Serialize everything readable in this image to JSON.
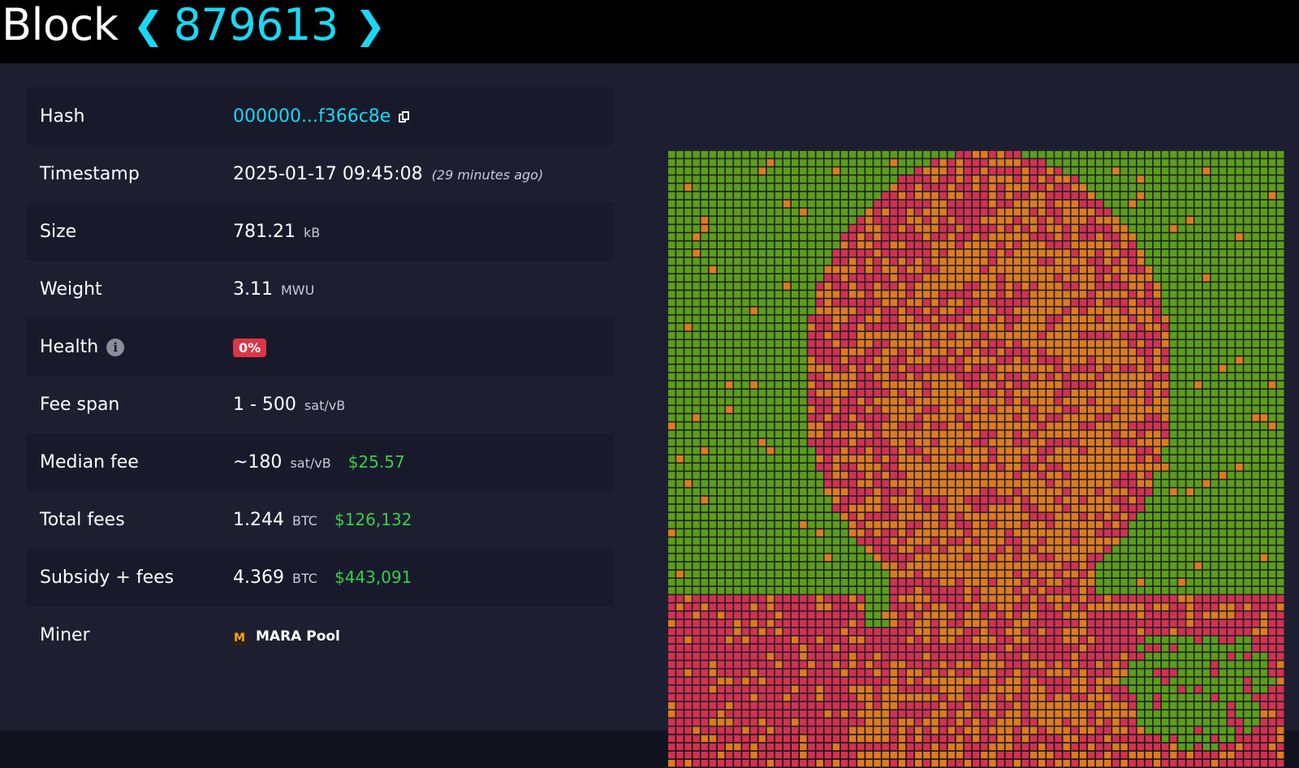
{
  "header": {
    "title": "Block",
    "prev_label": "❮",
    "block_height": "879613",
    "next_label": "❯"
  },
  "details": [
    {
      "label": "Hash",
      "value": "000000...f366c8e",
      "icon": "copy-icon"
    },
    {
      "label": "Timestamp",
      "value": "2025-01-17 09:45:08",
      "note": "(29 minutes ago)"
    },
    {
      "label": "Size",
      "value": "781.21",
      "unit": "kB"
    },
    {
      "label": "Weight",
      "value": "3.11",
      "unit": "MWU"
    },
    {
      "label": "Health",
      "value": "0%",
      "icon": "info-icon"
    },
    {
      "label": "Fee span",
      "value": "1 - 500",
      "unit": "sat/vB"
    },
    {
      "label": "Median fee",
      "value": "~180",
      "unit": "sat/vB",
      "usd": "$25.57"
    },
    {
      "label": "Total fees",
      "value": "1.244",
      "unit": "BTC",
      "usd": "$126,132"
    },
    {
      "label": "Subsidy + fees",
      "value": "4.369",
      "unit": "BTC",
      "usd": "$443,091"
    },
    {
      "label": "Miner",
      "value": "MARA Pool",
      "logo": "M"
    }
  ],
  "visualization": {
    "grid_cells_per_side": 75,
    "colors": {
      "low_fee": "#5c9e16",
      "mid_fee": "#e07b1c",
      "high_fee": "#d4314d",
      "background": "#1d1f31"
    }
  }
}
